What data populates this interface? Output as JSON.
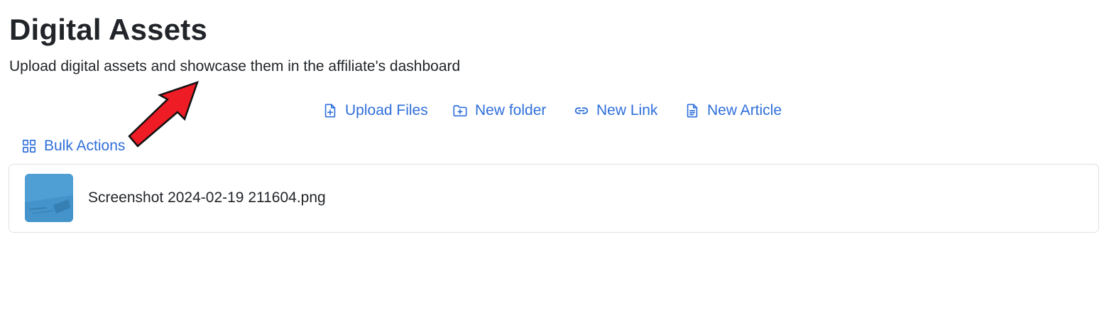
{
  "header": {
    "title": "Digital Assets",
    "subtitle": "Upload digital assets and showcase them in the affiliate's dashboard"
  },
  "toolbar": {
    "upload_files": {
      "label": "Upload Files",
      "icon": "file-plus-icon"
    },
    "new_folder": {
      "label": "New folder",
      "icon": "folder-plus-icon"
    },
    "new_link": {
      "label": "New Link",
      "icon": "link-icon"
    },
    "new_article": {
      "label": "New Article",
      "icon": "document-icon"
    }
  },
  "bulk_actions": {
    "label": "Bulk Actions",
    "icon": "grid-icon"
  },
  "files": [
    {
      "name": "Screenshot 2024-02-19 211604.png",
      "thumbnail": "image-thumbnail"
    }
  ],
  "annotation": {
    "icon": "red-arrow-icon",
    "color": "#ee1c25"
  },
  "colors": {
    "accent": "#2f6fdb",
    "text": "#212529",
    "border": "#dee2e6"
  }
}
